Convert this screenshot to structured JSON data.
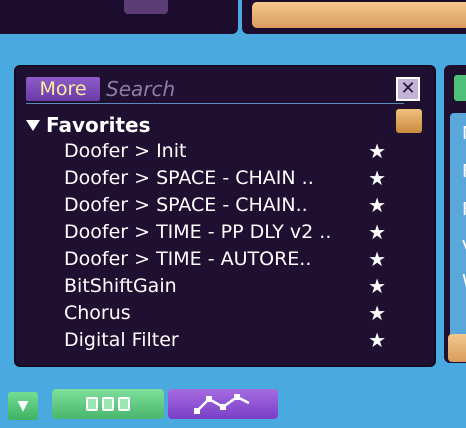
{
  "browser": {
    "more_label": "More",
    "search_placeholder": "Search",
    "close_label": "✕",
    "section_title": "Favorites",
    "items": [
      {
        "label": "Doofer > Init",
        "star": "★"
      },
      {
        "label": "Doofer > SPACE - CHAIN ..",
        "star": "★"
      },
      {
        "label": "Doofer > SPACE - CHAIN..",
        "star": "★"
      },
      {
        "label": "Doofer > TIME - PP DLY v2 ..",
        "star": "★"
      },
      {
        "label": "Doofer > TIME - AUTORE..",
        "star": "★"
      },
      {
        "label": "BitShiftGain",
        "star": "★"
      },
      {
        "label": "Chorus",
        "star": "★"
      },
      {
        "label": "Digital Filter",
        "star": "★"
      }
    ]
  },
  "right_panel": {
    "letters": [
      "M",
      "F",
      "F",
      "V",
      "W"
    ]
  },
  "bottom": {
    "collapse_icon": "▼"
  },
  "colors": {
    "background": "#4aa9de",
    "panel": "#1f0f31",
    "more_button": "#7b4bbb",
    "accent_orange": "#e0a868",
    "accent_green": "#5ccb82",
    "accent_purple": "#8f55d6"
  }
}
